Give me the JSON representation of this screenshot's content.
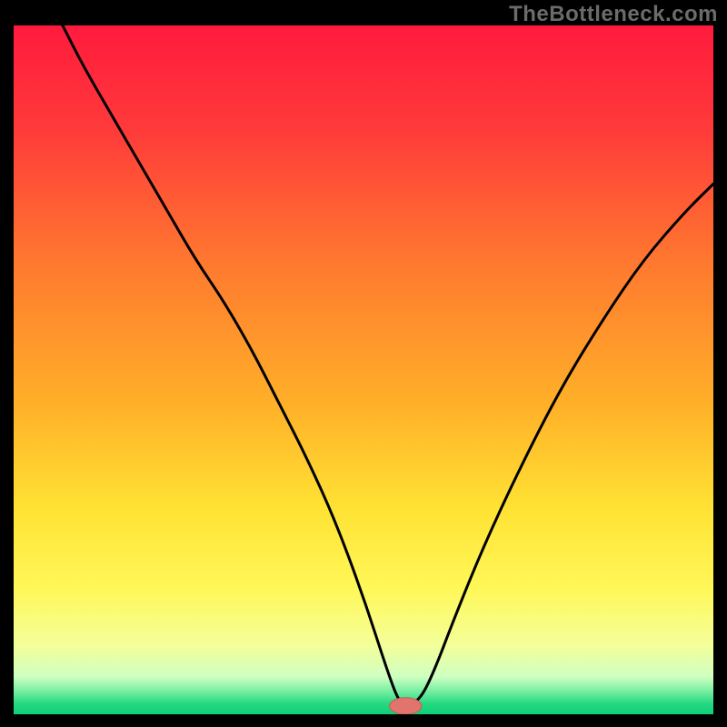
{
  "watermark": "TheBottleneck.com",
  "palette": {
    "black": "#000000",
    "curve": "#000000",
    "marker_fill": "#e2746e",
    "marker_stroke": "#c95a55",
    "gradient_stops": [
      {
        "offset": 0.0,
        "color": "#ff1a3d"
      },
      {
        "offset": 0.15,
        "color": "#ff3a3a"
      },
      {
        "offset": 0.35,
        "color": "#ff7a2f"
      },
      {
        "offset": 0.55,
        "color": "#ffb028"
      },
      {
        "offset": 0.7,
        "color": "#ffe233"
      },
      {
        "offset": 0.82,
        "color": "#fff85a"
      },
      {
        "offset": 0.9,
        "color": "#f4ff9a"
      },
      {
        "offset": 0.945,
        "color": "#cfffc0"
      },
      {
        "offset": 0.965,
        "color": "#7ef0a5"
      },
      {
        "offset": 0.985,
        "color": "#23d880"
      },
      {
        "offset": 1.0,
        "color": "#0ecf78"
      }
    ]
  },
  "chart_data": {
    "type": "line",
    "title": "",
    "xlabel": "",
    "ylabel": "",
    "xlim": [
      0,
      100
    ],
    "ylim": [
      0,
      100
    ],
    "marker": {
      "x": 56,
      "y": 1.2,
      "rx": 2.3,
      "ry": 1.2
    },
    "series": [
      {
        "name": "bottleneck-curve",
        "x": [
          7,
          10,
          14,
          18,
          22,
          26,
          30,
          34,
          38,
          42,
          46,
          50,
          53.5,
          55,
          56,
          58,
          60,
          63,
          67,
          72,
          78,
          84,
          90,
          96,
          100
        ],
        "y": [
          100,
          94,
          87,
          80,
          73,
          66,
          60,
          53,
          45,
          37,
          28,
          17,
          6,
          2,
          1.2,
          2,
          6,
          14,
          24,
          35,
          47,
          57,
          66,
          73,
          77
        ]
      }
    ]
  }
}
